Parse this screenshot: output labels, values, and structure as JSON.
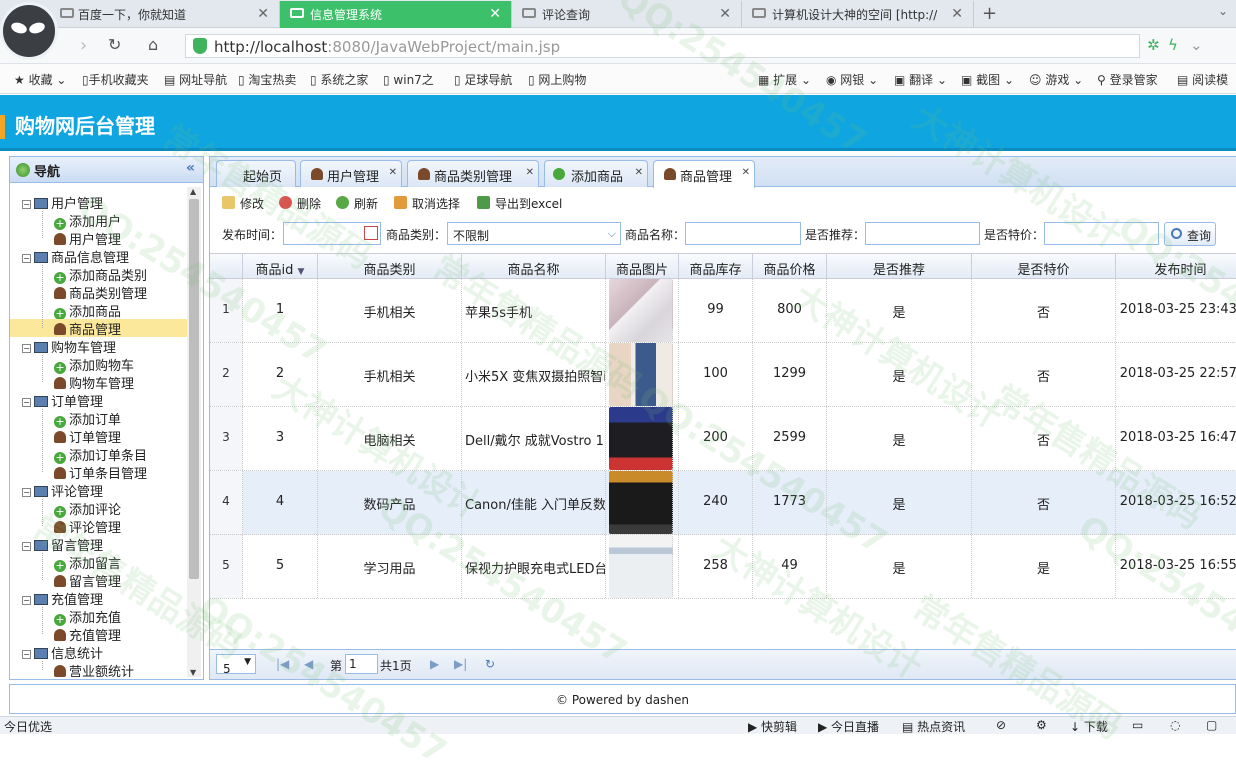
{
  "browser": {
    "tabs": [
      {
        "label": "百度一下，你就知道",
        "active": false
      },
      {
        "label": "信息管理系统",
        "active": true
      },
      {
        "label": "评论查询",
        "active": false
      },
      {
        "label": "计算机设计大神的空间 [http://2",
        "active": false
      }
    ],
    "new_tab": "+",
    "url_host": "http://localhost",
    "url_rest": ":8080/JavaWebProject/main.jsp",
    "bookmarks": [
      "收藏",
      "手机收藏夹",
      "网址导航",
      "淘宝热卖",
      "系统之家",
      "win7之",
      "足球导航",
      "网上购物"
    ],
    "right_tools": [
      "扩展",
      "网银",
      "翻译",
      "截图",
      "游戏",
      "登录管家",
      "阅读模"
    ]
  },
  "app": {
    "title": "购物网后台管理",
    "nav_title": "导航",
    "footer": "© Powered by dashen",
    "tree": [
      {
        "label": "用户管理",
        "children": [
          "添加用户",
          "用户管理"
        ]
      },
      {
        "label": "商品信息管理",
        "children": [
          "添加商品类别",
          "商品类别管理",
          "添加商品",
          "商品管理"
        ]
      },
      {
        "label": "购物车管理",
        "children": [
          "添加购物车",
          "购物车管理"
        ]
      },
      {
        "label": "订单管理",
        "children": [
          "添加订单",
          "订单管理",
          "添加订单条目",
          "订单条目管理"
        ]
      },
      {
        "label": "评论管理",
        "children": [
          "添加评论",
          "评论管理"
        ]
      },
      {
        "label": "留言管理",
        "children": [
          "添加留言",
          "留言管理"
        ]
      },
      {
        "label": "充值管理",
        "children": [
          "添加充值",
          "充值管理"
        ]
      },
      {
        "label": "信息统计",
        "children": [
          "营业额统计"
        ]
      }
    ],
    "page_tabs": [
      "起始页",
      "用户管理",
      "商品类别管理",
      "添加商品",
      "商品管理"
    ],
    "toolbar": [
      "修改",
      "删除",
      "刷新",
      "取消选择",
      "导出到excel"
    ],
    "filters": {
      "publish_time": "发布时间：",
      "category": "商品类别：",
      "category_value": "不限制",
      "name": "商品名称：",
      "recommend": "是否推荐：",
      "special": "是否特价：",
      "query": "查询"
    },
    "columns": [
      "商品id",
      "商品类别",
      "商品名称",
      "商品图片",
      "商品库存",
      "商品价格",
      "是否推荐",
      "是否特价",
      "发布时间"
    ],
    "rows": [
      {
        "n": "1",
        "id": "1",
        "cat": "手机相关",
        "name": "苹果5s手机",
        "stock": "99",
        "price": "800",
        "rec": "是",
        "sp": "否",
        "time": "2018-03-25 23:43:"
      },
      {
        "n": "2",
        "id": "2",
        "cat": "手机相关",
        "name": "小米5X 变焦双摄拍照智i",
        "stock": "100",
        "price": "1299",
        "rec": "是",
        "sp": "否",
        "time": "2018-03-25 22:57:"
      },
      {
        "n": "3",
        "id": "3",
        "cat": "电脑相关",
        "name": "Dell/戴尔 成就Vostro 1",
        "stock": "200",
        "price": "2599",
        "rec": "是",
        "sp": "否",
        "time": "2018-03-25 16:47:"
      },
      {
        "n": "4",
        "id": "4",
        "cat": "数码产品",
        "name": "Canon/佳能 入门单反数",
        "stock": "240",
        "price": "1773",
        "rec": "是",
        "sp": "否",
        "time": "2018-03-25 16:52:"
      },
      {
        "n": "5",
        "id": "5",
        "cat": "学习用品",
        "name": "保视力护眼充电式LED台",
        "stock": "258",
        "price": "49",
        "rec": "是",
        "sp": "是",
        "time": "2018-03-25 16:55:"
      }
    ],
    "pager": {
      "size": "5",
      "page_prefix": "第",
      "page": "1",
      "total": "共1页"
    }
  },
  "statusbar": {
    "left": "今日优选",
    "right": [
      "快剪辑",
      "今日直播",
      "热点资讯",
      "下载"
    ]
  },
  "watermarks": [
    "QQ:254540457",
    "常年售精品源码",
    "大神计算机设计"
  ]
}
